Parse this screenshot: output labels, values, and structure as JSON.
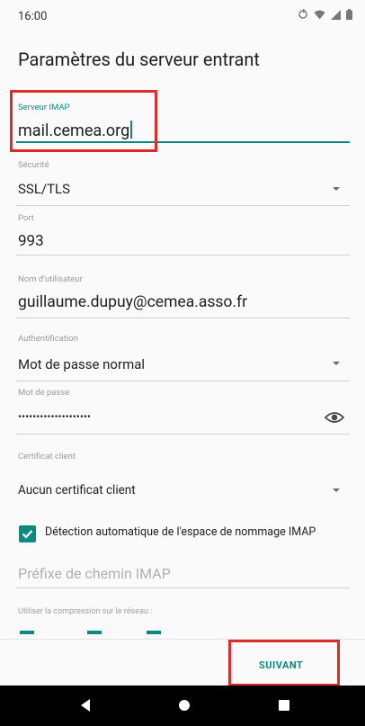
{
  "status_bar": {
    "time": "16:00"
  },
  "page": {
    "title": "Paramètres du serveur entrant"
  },
  "fields": {
    "server": {
      "label": "Serveur IMAP",
      "value": "mail.cemea.org"
    },
    "security": {
      "label": "Sécurité",
      "value": "SSL/TLS"
    },
    "port": {
      "label": "Port",
      "value": "993"
    },
    "username": {
      "label": "Nom d'utilisateur",
      "value": "guillaume.dupuy@cemea.asso.fr"
    },
    "auth": {
      "label": "Authentification",
      "value": "Mot de passe normal"
    },
    "password": {
      "label": "Mot de passe",
      "value": "••••••••••••••••••••"
    },
    "certificate": {
      "label": "Certificat client",
      "value": "Aucun certificat client"
    }
  },
  "autodetect": {
    "checked": true,
    "label": "Détection automatique de l'espace de nommage IMAP"
  },
  "prefix": {
    "placeholder": "Préfixe de chemin IMAP"
  },
  "compression": {
    "label": "Utiliser la compression sur le réseau :"
  },
  "actions": {
    "next_label": "SUIVANT"
  },
  "colors": {
    "accent": "#0b8a7e",
    "highlight": "#e02b2b"
  }
}
